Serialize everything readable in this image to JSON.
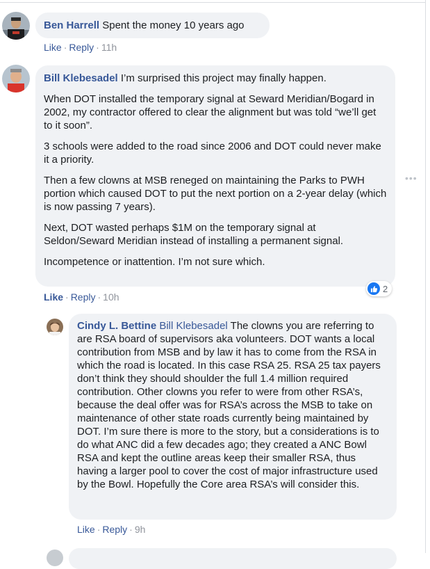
{
  "comments": [
    {
      "author": "Ben Harrell",
      "text": "Spent the money 10 years ago",
      "actions": {
        "like": "Like",
        "reply": "Reply",
        "time": "11h"
      }
    },
    {
      "author": "Bill Klebesadel",
      "paragraphs": [
        "I’m surprised this project may finally happen.",
        "When DOT installed the temporary signal at Seward Meridian/Bogard in 2002, my contractor offered to clear the alignment but was told “we’ll get to it soon”.",
        "3 schools were added to the road since 2006 and DOT could never make it a priority.",
        "Then a few clowns at MSB reneged on maintaining the Parks to PWH portion which caused DOT to put the next portion on a 2-year delay (which is now passing 7 years).",
        "Next, DOT wasted perhaps $1M on the temporary signal at Seldon/Seward Meridian instead of installing a permanent signal.",
        "Incompetence or inattention. I’m not sure which."
      ],
      "reaction_count": "2",
      "more_icon": "more-horizontal-icon",
      "actions": {
        "like": "Like",
        "reply": "Reply",
        "time": "10h"
      }
    },
    {
      "author": "Cindy L. Bettine",
      "mention": "Bill Klebesadel",
      "text": "The clowns you are referring to are RSA board of supervisors aka volunteers. DOT wants a local contribution from MSB and by law it has to come from the RSA in which the road is located. In this case RSA 25. RSA 25 tax payers don’t think they should shoulder the full 1.4 million required contribution. Other clowns you refer to were from other RSA’s, because the deal offer was for RSA’s across the MSB to take on maintenance of other state roads currently being maintained by DOT. I’m sure there is more to the story, but a considerations is to do what ANC did a few decades ago; they created a ANC Bowl RSA and kept the outline areas keep their smaller RSA, thus having a larger pool to cover the cost of major infrastructure used by the Bowl. Hopefully the Core area RSA’s will consider this.",
      "actions": {
        "like": "Like",
        "reply": "Reply",
        "time": "9h"
      }
    }
  ],
  "colors": {
    "link": "#385898",
    "bubble": "#f0f2f5",
    "like_blue": "#1877f2",
    "meta": "#90949c"
  }
}
